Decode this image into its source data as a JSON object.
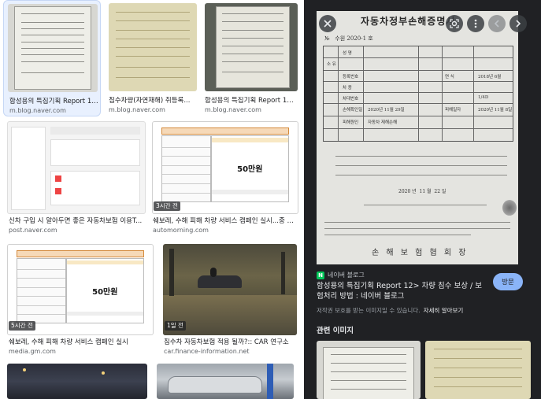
{
  "results": [
    {
      "title": "함성용의 특집기획 Report 12...",
      "source": "m.blog.naver.com",
      "badge": ""
    },
    {
      "title": "침수차량(자연재해) 취등록...",
      "source": "m.blog.naver.com",
      "badge": ""
    },
    {
      "title": "함성용의 특집기획 Report 12>...",
      "source": "m.blog.naver.com",
      "badge": ""
    },
    {
      "title": "신차 구입 시 알아두면 좋은 자동차보험 이용T...",
      "source": "post.naver.com",
      "badge": ""
    },
    {
      "title": "쉐보레, 수해 피해 차량 서비스 캠페인 실시...중 수...",
      "source": "automorning.com",
      "badge": "3시간 전"
    },
    {
      "title": "쉐보레, 수해 피해 차량 서비스 캠페인 실시",
      "source": "media.gm.com",
      "badge": "5시간 전"
    },
    {
      "title": "침수차 자동차보험 적용 될까?:: CAR 연구소",
      "source": "car.finance-information.net",
      "badge": "1일 전"
    }
  ],
  "promo": {
    "amount": "50만원"
  },
  "viewer": {
    "doc_title": "자동차정부손해증명서",
    "site_name": "네이버 블로그",
    "favicon_letter": "N",
    "title": "함성용의 특집기획 Report 12> 차량 침수 보상 / 보험처리 방법 : 네이버 블로그",
    "visit_label": "방문",
    "copyright": "저작권 보호를 받는 이미지일 수 있습니다.",
    "learn_more": "자세히 알아보기",
    "related_title": "관련 이미지",
    "icons": {
      "close": "close-icon",
      "lens": "lens-icon",
      "more": "more-vert-icon",
      "prev": "chevron-left-icon",
      "next": "chevron-right-icon"
    }
  },
  "colors": {
    "viewer_bg": "#202124",
    "accent": "#8ab4f8",
    "naver_green": "#03c75a"
  }
}
